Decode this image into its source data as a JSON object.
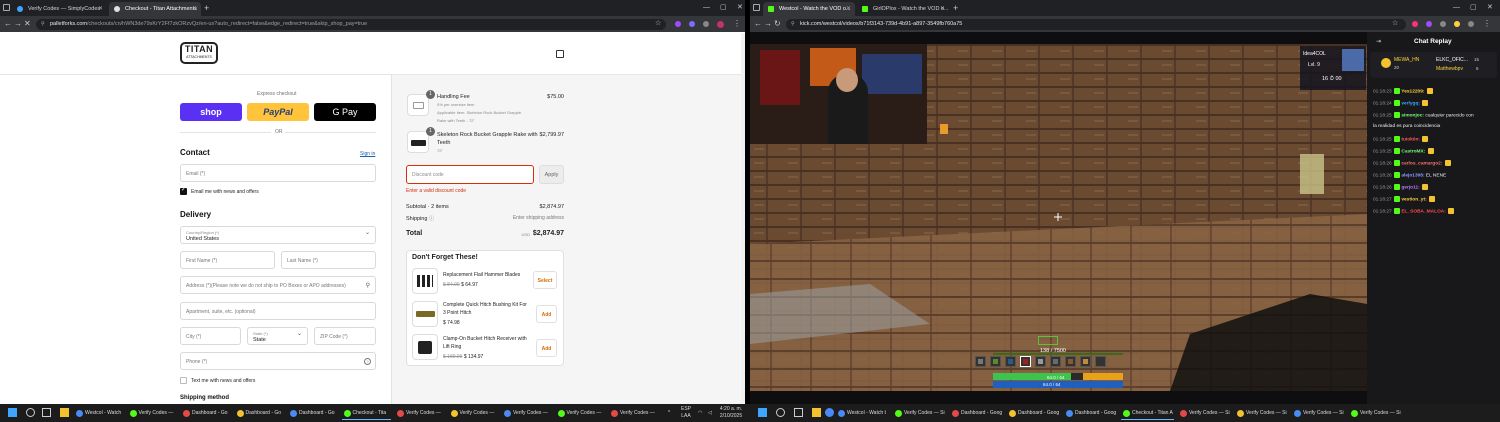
{
  "left_browser": {
    "tabs": [
      {
        "label": "Verify Codes — SimplyCodes",
        "active": false,
        "favicon_color": "#3ea6ff"
      },
      {
        "label": "Checkout - Titan Attachments",
        "active": true,
        "favicon_color": "#e0e0e0"
      }
    ],
    "url_main": "palletforks.com",
    "url_rest": "/checkouts/cn/hWN3de79sKrY2Ff7zkORzvQz/en-us?auto_redirect=false&edge_redirect=true&skip_shop_pay=true"
  },
  "checkout": {
    "logo_main": "TITAN",
    "logo_sub": "ATTACHMENTS",
    "express_label": "Express checkout",
    "pay_buttons": {
      "shop": "shop",
      "paypal": "PayPal",
      "gpay": "G Pay"
    },
    "or_label": "OR",
    "contact": {
      "heading": "Contact",
      "signin": "Sign in",
      "email_placeholder": "Email (*)",
      "news_label": "Email me with news and offers"
    },
    "delivery": {
      "heading": "Delivery",
      "country_label": "Country/Region (*)",
      "country_value": "United States",
      "first_name": "First Name (*)",
      "last_name": "Last Name (*)",
      "address": "Address (*)(Please note we do not ship to PO Boxes or APO addresses)",
      "apartment": "Apartment, suite, etc. (optional)",
      "city": "City (*)",
      "state_label": "State (*)",
      "state_value": "State",
      "zip": "ZIP Code (*)",
      "phone": "Phone (*)",
      "text_news": "Text me with news and offers"
    },
    "shipping_method": "Shipping method"
  },
  "summary": {
    "items": [
      {
        "qty": "1",
        "name": "Handling Fee",
        "sub1": "0% per oversize item",
        "sub2": "Applicable Item: Skeleton Rock Bucket Grapple",
        "sub3": "Rake with Teeth - 72\"",
        "price": "$75.00"
      },
      {
        "qty": "1",
        "name": "Skeleton Rock Bucket Grapple Rake with",
        "name2": "Teeth",
        "sub1": "72\"",
        "price": "$2,799.97"
      }
    ],
    "discount_placeholder": "Discount code",
    "apply_label": "Apply",
    "discount_error": "Enter a valid discount code",
    "subtotal_label": "Subtotal · 2 items",
    "subtotal_value": "$2,874.97",
    "shipping_label": "Shipping",
    "shipping_value": "Enter shipping address",
    "total_label": "Total",
    "currency": "USD",
    "total_value": "$2,874.97",
    "upsell_title": "Don't Forget These!",
    "upsells": [
      {
        "name": "Replacement Flail Hammer Blades",
        "name2": "",
        "old_price": "$ 84.99",
        "price": "$ 64.97",
        "button": "Select"
      },
      {
        "name": "Complete Quick Hitch Bushing Kit For",
        "name2": "3 Point Hitch",
        "old_price": "",
        "price": "$ 74.98",
        "button": "Add"
      },
      {
        "name": "Clamp-On Bucket Hitch Receiver with",
        "name2": "Lift Ring",
        "old_price": "$ 189.99",
        "price": "$ 134.97",
        "button": "Add"
      }
    ]
  },
  "right_browser": {
    "tabs": [
      {
        "label": "Westcol - Watch the VOD o...",
        "active": true,
        "favicon_color": "#53fc18"
      },
      {
        "label": "GirlOPlox - Watch the VOD o...",
        "active": false,
        "favicon_color": "#53fc18"
      }
    ],
    "url": "kick.com/westcol/videos/b71f3143-739d-4b91-a897-3549fb760a75"
  },
  "game_hud": {
    "xp_text": "138 / 7500",
    "hp_text": "64.0 / 64",
    "mana_text": "64.0 / 64",
    "scoreboard_name": "Idea4COL",
    "scoreboard_level": "Lvl. 9",
    "scoreboard_stats": "16 ⏱ 00"
  },
  "chat": {
    "title": "Chat Replay",
    "pinned_user1": "MEWA_HN",
    "pinned_count1": "20",
    "pinned_user2": "ELKC_OFIC...",
    "pinned_count2": "15",
    "pinned_user3": "Matthewbpv",
    "pinned_count3": "6",
    "messages": [
      {
        "time": "01:18:23",
        "user": "Yes12209",
        "color": "#ffd23d",
        "text": ""
      },
      {
        "time": "01:18:24",
        "user": "verlygq",
        "color": "#3ea6ff",
        "text": ""
      },
      {
        "time": "01:18:25",
        "user": "simonjoc",
        "color": "#7cfc7c",
        "text": "cualquier parecido con"
      },
      {
        "time": "",
        "user": "",
        "color": "#eeeeee",
        "text": "la realidad es pura coincidencia"
      },
      {
        "time": "01:18:25",
        "user": "tuiok0n",
        "color": "#ff5a5a",
        "text": ""
      },
      {
        "time": "01:18:25",
        "user": "CastroMX",
        "color": "#7cfc7c",
        "text": ""
      },
      {
        "time": "01:18:26",
        "user": "carlos_camargo2",
        "color": "#ff6e6e",
        "text": ""
      },
      {
        "time": "01:18:26",
        "user": "alejo1308",
        "color": "#8c9cff",
        "text": "EL NENE"
      },
      {
        "time": "01:18:26",
        "user": "gerjo11",
        "color": "#b77cff",
        "text": ""
      },
      {
        "time": "01:18:27",
        "user": "vestion_yt",
        "color": "#ffd23d",
        "text": ""
      },
      {
        "time": "01:18:27",
        "user": "EL_SOBA_MALOA",
        "color": "#ff4d4d",
        "text": ""
      }
    ]
  },
  "taskbar_left": {
    "items": [
      "Westcol - Watch",
      "Verify Codes —",
      "Dashboard - Go",
      "Dashboard - Go",
      "Dashboard - Go",
      "Checkout - Tita",
      "Verify Codes —",
      "Verify Codes —",
      "Verify Codes —",
      "Verify Codes —",
      "Verify Codes —"
    ],
    "lang": "ESP",
    "lang2": "LAA",
    "time": "4:20 a. m.",
    "date": "2/10/2025"
  },
  "taskbar_right": {
    "items": [
      "Westcol - Watch t",
      "Verify Codes — Si",
      "Dashboard - Goog",
      "Dashboard - Goog",
      "Dashboard - Goog",
      "Checkout - Titan A",
      "Verify Codes — Si",
      "Verify Codes — Si",
      "Verify Codes — Si",
      "Verify Codes — Si"
    ],
    "time": "4:20 a. m.",
    "date": "2/10/2025"
  },
  "colors": {
    "shop": "#5a31f4",
    "paypal": "#ffc439",
    "error": "#d82c0d",
    "kick_green": "#53fc18"
  }
}
